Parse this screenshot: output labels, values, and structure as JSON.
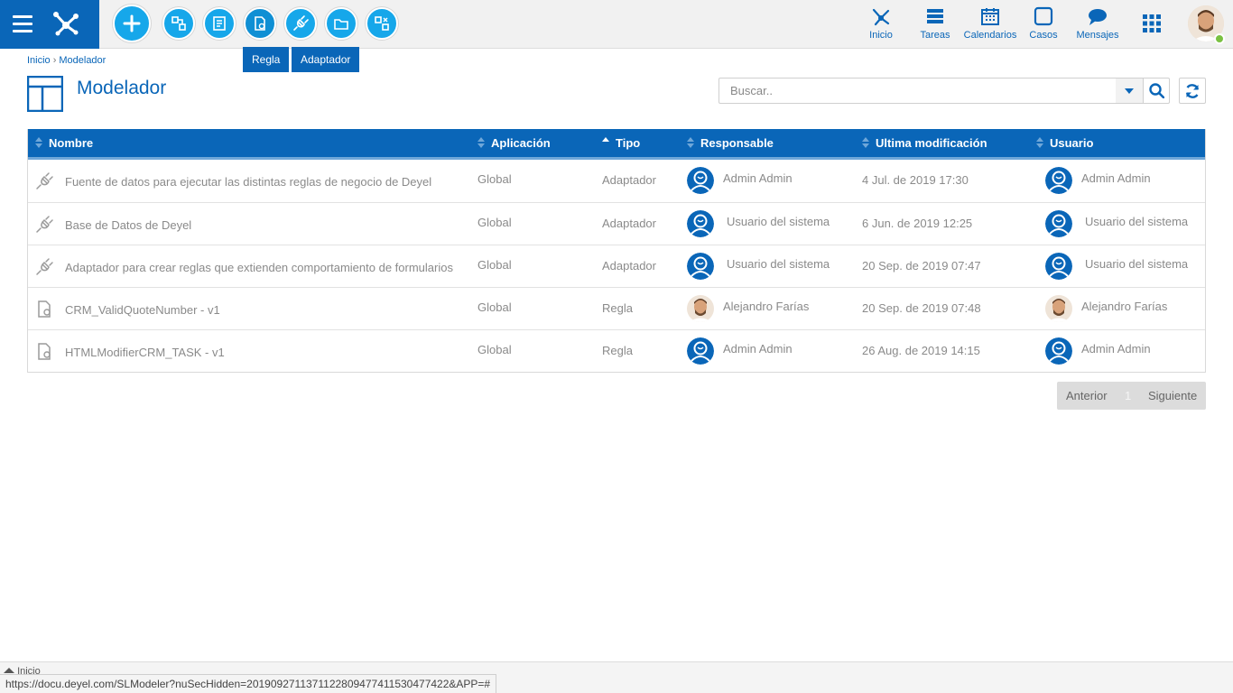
{
  "topbar": {
    "tooltips": {
      "regla": "Regla",
      "adaptador": "Adaptador"
    },
    "nav": [
      {
        "label": "Inicio",
        "icon": "deyel-logo-icon"
      },
      {
        "label": "Tareas",
        "icon": "tasks-icon"
      },
      {
        "label": "Calendarios",
        "icon": "calendar-icon"
      },
      {
        "label": "Casos",
        "icon": "cases-icon"
      },
      {
        "label": "Mensajes",
        "icon": "chat-icon"
      }
    ]
  },
  "breadcrumb": {
    "home": "Inicio",
    "sep": "›",
    "current": "Modelador"
  },
  "page": {
    "title": "Modelador"
  },
  "search": {
    "placeholder": "Buscar.."
  },
  "table": {
    "columns": [
      "Nombre",
      "Aplicación",
      "Tipo",
      "Responsable",
      "Ultima modificación",
      "Usuario"
    ],
    "rows": [
      {
        "icon": "adapter-plug-icon",
        "nombre": "Fuente de datos para ejecutar las distintas reglas de negocio de Deyel",
        "aplicacion": "Global",
        "tipo": "Adaptador",
        "responsable": "Admin Admin",
        "modificacion": "4 Jul. de 2019 17:30",
        "usuario": "Admin Admin",
        "avatar": "default"
      },
      {
        "icon": "adapter-plug-icon",
        "nombre": "Base de Datos de Deyel",
        "aplicacion": "Global",
        "tipo": "Adaptador",
        "responsable": "Usuario del sistema",
        "modificacion": "6 Jun. de 2019 12:25",
        "usuario": "Usuario del sistema",
        "avatar": "default"
      },
      {
        "icon": "adapter-plug-icon",
        "nombre": "Adaptador para crear reglas que extienden comportamiento de formularios",
        "aplicacion": "Global",
        "tipo": "Adaptador",
        "responsable": "Usuario del sistema",
        "modificacion": "20 Sep. de 2019 07:47",
        "usuario": "Usuario del sistema",
        "avatar": "default"
      },
      {
        "icon": "rule-document-icon",
        "nombre": "CRM_ValidQuoteNumber - v1",
        "aplicacion": "Global",
        "tipo": "Regla",
        "responsable": "Alejandro Farías",
        "modificacion": "20 Sep. de 2019 07:48",
        "usuario": "Alejandro Farías",
        "avatar": "photo"
      },
      {
        "icon": "rule-document-icon",
        "nombre": "HTMLModifierCRM_TASK - v1",
        "aplicacion": "Global",
        "tipo": "Regla",
        "responsable": "Admin Admin",
        "modificacion": "26 Aug. de 2019 14:15",
        "usuario": "Admin Admin",
        "avatar": "default"
      }
    ]
  },
  "pager": {
    "prev": "Anterior",
    "page": "1",
    "next": "Siguiente"
  },
  "footer": {
    "tab": "Inicio",
    "url": "https://docu.deyel.com/SLModeler?nuSecHidden=201909271137112280947741153047742​2&APP=#"
  },
  "colors": {
    "primary": "#0a66b8",
    "accent": "#16a7ea",
    "online": "#7ac142"
  }
}
